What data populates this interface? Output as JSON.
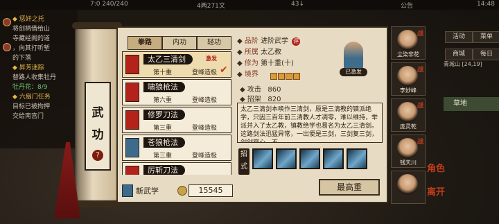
{
  "top": {
    "coords": "7:0  240/240",
    "money": "4两271文",
    "count": "43↓",
    "announce": "公告",
    "time": "14:48"
  },
  "quest": {
    "lines": [
      {
        "text": "◆ 惩奸之托",
        "cls": "head"
      },
      {
        "text": "将剑柄借给山",
        "cls": ""
      },
      {
        "text": "寺藏经阁的道",
        "cls": ""
      },
      {
        "text": "，向其打听堑",
        "cls": ""
      },
      {
        "text": "的下落",
        "cls": ""
      },
      {
        "text": "◆ 昇芳迷踪",
        "cls": "head"
      },
      {
        "text": "替路人收集牡丹",
        "cls": ""
      },
      {
        "text": "牡丹花：8/9",
        "cls": "green"
      },
      {
        "text": "◆ 六扇门任务",
        "cls": "head"
      },
      {
        "text": "目标已被拘押",
        "cls": ""
      },
      {
        "text": "交给南宫门",
        "cls": ""
      }
    ]
  },
  "right_buttons": [
    "活动",
    "菜单",
    "商城",
    "每日"
  ],
  "map": {
    "place": "青城山",
    "coords": "[24,19]",
    "terrain": "草地"
  },
  "scroll": {
    "char1": "武",
    "char2": "功",
    "help": "?"
  },
  "tabs": [
    "拳路",
    "内功",
    "轻功"
  ],
  "skills": [
    {
      "name": "太乙三清剑",
      "tag": "激发",
      "layer": "第十重",
      "grade": "登峰造极",
      "color": "#b3231b"
    },
    {
      "name": "啸狼枪法",
      "tag": "",
      "layer": "第六重",
      "grade": "登峰造极",
      "color": "#b3231b"
    },
    {
      "name": "修罗刀法",
      "tag": "",
      "layer": "第三重",
      "grade": "登峰造极",
      "color": "#b3231b"
    },
    {
      "name": "苍狼枪法",
      "tag": "",
      "layer": "第三重",
      "grade": "登峰造极",
      "color": "#3d6b8c"
    },
    {
      "name": "厉斩刀法",
      "tag": "",
      "layer": "",
      "grade": "",
      "color": "#b3231b"
    }
  ],
  "newbar": {
    "label": "新武学",
    "amount": "15545"
  },
  "detail": {
    "grade_label": "品阶",
    "grade": "进阶武学",
    "seal": "评",
    "school_label": "所属",
    "school": "太乙教",
    "xiuwei_label": "修为",
    "xiuwei": "第十重(十)",
    "jingjie_label": "境界",
    "status": "已激发",
    "attack_label": "攻击",
    "attack": "860",
    "parry_label": "招架",
    "parry": "820",
    "desc": "太乙三清剑本唤作三清剑，原是三清教的镇派绝学，只因三百年前三清教人才凋零，难以维持，举派并入了太乙教，镇教绝学也易名为太乙三清剑。这路剑法迅猛异常，一出便是三剑，三剑复三剑，剑剑穿心，不",
    "moves_label": "招式",
    "max_btn": "最高重"
  },
  "roster": [
    {
      "name": "尘染非花"
    },
    {
      "name": "李妙峰"
    },
    {
      "name": "庞灵乾"
    },
    {
      "name": "钱天川"
    },
    {
      "name": ""
    }
  ],
  "side_tags": [
    "角色",
    "离开"
  ]
}
